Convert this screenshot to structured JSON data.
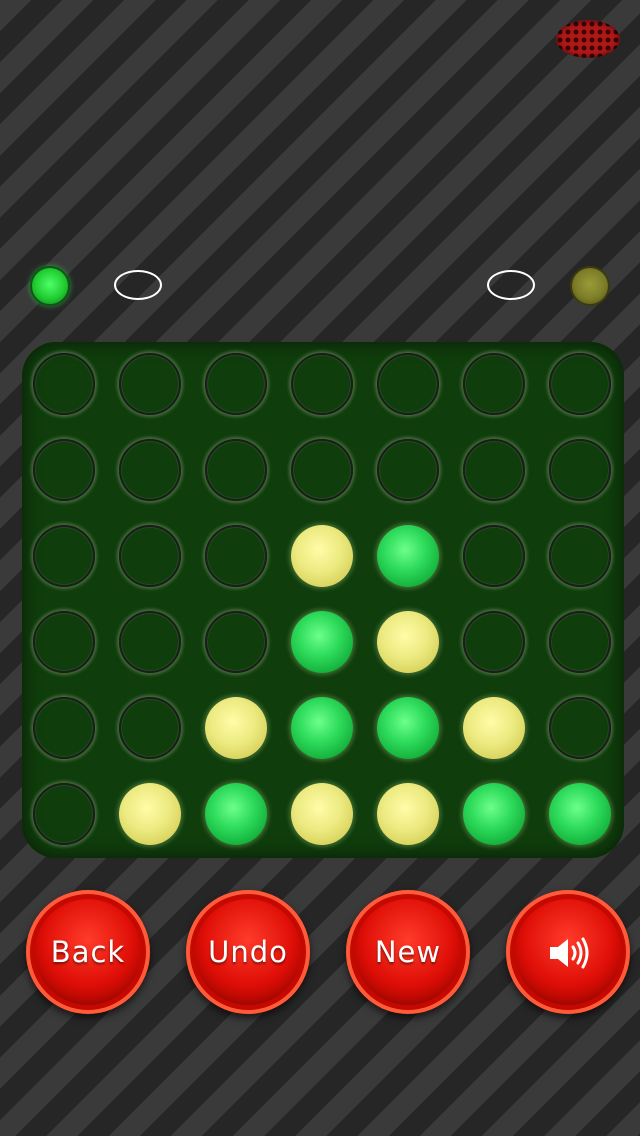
{
  "header": {
    "logo_icon": "dotted-red-oval-logo-icon"
  },
  "players": [
    {
      "color": "green",
      "hex": "#22cc33",
      "indicator_state": "active",
      "score_ring": "empty"
    },
    {
      "color": "yellow",
      "hex": "#7d7d28",
      "indicator_state": "inactive",
      "score_ring": "empty"
    }
  ],
  "board": {
    "columns": 7,
    "rows_count": 6,
    "frame_color": "#0f3d0c",
    "rows": [
      [
        "",
        "",
        "",
        "",
        "",
        "",
        ""
      ],
      [
        "",
        "",
        "",
        "",
        "",
        "",
        ""
      ],
      [
        "",
        "",
        "",
        "Y",
        "G",
        "",
        ""
      ],
      [
        "",
        "",
        "",
        "G",
        "Y",
        "",
        ""
      ],
      [
        "",
        "",
        "Y",
        "G",
        "G",
        "Y",
        ""
      ],
      [
        "",
        "Y",
        "G",
        "Y",
        "Y",
        "G",
        "G"
      ]
    ],
    "colors": {
      "G": "#2fdc5c",
      "Y": "#ecea80"
    }
  },
  "controls": {
    "back_label": "Back",
    "undo_label": "Undo",
    "new_label": "New",
    "sound_icon": "speaker-volume-icon",
    "button_color": "#e01008"
  }
}
